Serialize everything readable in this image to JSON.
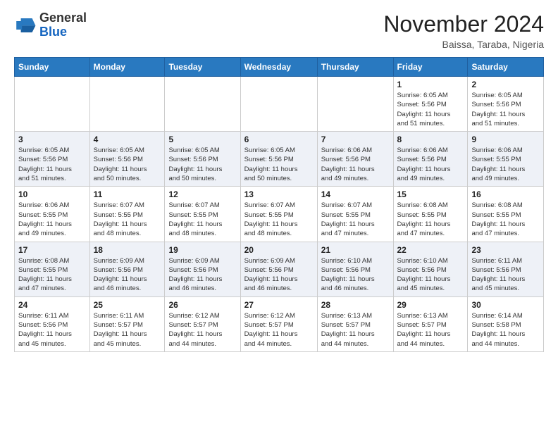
{
  "header": {
    "logo_general": "General",
    "logo_blue": "Blue",
    "month_title": "November 2024",
    "location": "Baissa, Taraba, Nigeria"
  },
  "calendar": {
    "days_of_week": [
      "Sunday",
      "Monday",
      "Tuesday",
      "Wednesday",
      "Thursday",
      "Friday",
      "Saturday"
    ],
    "weeks": [
      {
        "id": "week1",
        "days": [
          {
            "date": "",
            "info": ""
          },
          {
            "date": "",
            "info": ""
          },
          {
            "date": "",
            "info": ""
          },
          {
            "date": "",
            "info": ""
          },
          {
            "date": "",
            "info": ""
          },
          {
            "date": "1",
            "info": "Sunrise: 6:05 AM\nSunset: 5:56 PM\nDaylight: 11 hours\nand 51 minutes."
          },
          {
            "date": "2",
            "info": "Sunrise: 6:05 AM\nSunset: 5:56 PM\nDaylight: 11 hours\nand 51 minutes."
          }
        ]
      },
      {
        "id": "week2",
        "days": [
          {
            "date": "3",
            "info": "Sunrise: 6:05 AM\nSunset: 5:56 PM\nDaylight: 11 hours\nand 51 minutes."
          },
          {
            "date": "4",
            "info": "Sunrise: 6:05 AM\nSunset: 5:56 PM\nDaylight: 11 hours\nand 50 minutes."
          },
          {
            "date": "5",
            "info": "Sunrise: 6:05 AM\nSunset: 5:56 PM\nDaylight: 11 hours\nand 50 minutes."
          },
          {
            "date": "6",
            "info": "Sunrise: 6:05 AM\nSunset: 5:56 PM\nDaylight: 11 hours\nand 50 minutes."
          },
          {
            "date": "7",
            "info": "Sunrise: 6:06 AM\nSunset: 5:56 PM\nDaylight: 11 hours\nand 49 minutes."
          },
          {
            "date": "8",
            "info": "Sunrise: 6:06 AM\nSunset: 5:56 PM\nDaylight: 11 hours\nand 49 minutes."
          },
          {
            "date": "9",
            "info": "Sunrise: 6:06 AM\nSunset: 5:55 PM\nDaylight: 11 hours\nand 49 minutes."
          }
        ]
      },
      {
        "id": "week3",
        "days": [
          {
            "date": "10",
            "info": "Sunrise: 6:06 AM\nSunset: 5:55 PM\nDaylight: 11 hours\nand 49 minutes."
          },
          {
            "date": "11",
            "info": "Sunrise: 6:07 AM\nSunset: 5:55 PM\nDaylight: 11 hours\nand 48 minutes."
          },
          {
            "date": "12",
            "info": "Sunrise: 6:07 AM\nSunset: 5:55 PM\nDaylight: 11 hours\nand 48 minutes."
          },
          {
            "date": "13",
            "info": "Sunrise: 6:07 AM\nSunset: 5:55 PM\nDaylight: 11 hours\nand 48 minutes."
          },
          {
            "date": "14",
            "info": "Sunrise: 6:07 AM\nSunset: 5:55 PM\nDaylight: 11 hours\nand 47 minutes."
          },
          {
            "date": "15",
            "info": "Sunrise: 6:08 AM\nSunset: 5:55 PM\nDaylight: 11 hours\nand 47 minutes."
          },
          {
            "date": "16",
            "info": "Sunrise: 6:08 AM\nSunset: 5:55 PM\nDaylight: 11 hours\nand 47 minutes."
          }
        ]
      },
      {
        "id": "week4",
        "days": [
          {
            "date": "17",
            "info": "Sunrise: 6:08 AM\nSunset: 5:55 PM\nDaylight: 11 hours\nand 47 minutes."
          },
          {
            "date": "18",
            "info": "Sunrise: 6:09 AM\nSunset: 5:56 PM\nDaylight: 11 hours\nand 46 minutes."
          },
          {
            "date": "19",
            "info": "Sunrise: 6:09 AM\nSunset: 5:56 PM\nDaylight: 11 hours\nand 46 minutes."
          },
          {
            "date": "20",
            "info": "Sunrise: 6:09 AM\nSunset: 5:56 PM\nDaylight: 11 hours\nand 46 minutes."
          },
          {
            "date": "21",
            "info": "Sunrise: 6:10 AM\nSunset: 5:56 PM\nDaylight: 11 hours\nand 46 minutes."
          },
          {
            "date": "22",
            "info": "Sunrise: 6:10 AM\nSunset: 5:56 PM\nDaylight: 11 hours\nand 45 minutes."
          },
          {
            "date": "23",
            "info": "Sunrise: 6:11 AM\nSunset: 5:56 PM\nDaylight: 11 hours\nand 45 minutes."
          }
        ]
      },
      {
        "id": "week5",
        "days": [
          {
            "date": "24",
            "info": "Sunrise: 6:11 AM\nSunset: 5:56 PM\nDaylight: 11 hours\nand 45 minutes."
          },
          {
            "date": "25",
            "info": "Sunrise: 6:11 AM\nSunset: 5:57 PM\nDaylight: 11 hours\nand 45 minutes."
          },
          {
            "date": "26",
            "info": "Sunrise: 6:12 AM\nSunset: 5:57 PM\nDaylight: 11 hours\nand 44 minutes."
          },
          {
            "date": "27",
            "info": "Sunrise: 6:12 AM\nSunset: 5:57 PM\nDaylight: 11 hours\nand 44 minutes."
          },
          {
            "date": "28",
            "info": "Sunrise: 6:13 AM\nSunset: 5:57 PM\nDaylight: 11 hours\nand 44 minutes."
          },
          {
            "date": "29",
            "info": "Sunrise: 6:13 AM\nSunset: 5:57 PM\nDaylight: 11 hours\nand 44 minutes."
          },
          {
            "date": "30",
            "info": "Sunrise: 6:14 AM\nSunset: 5:58 PM\nDaylight: 11 hours\nand 44 minutes."
          }
        ]
      }
    ]
  }
}
